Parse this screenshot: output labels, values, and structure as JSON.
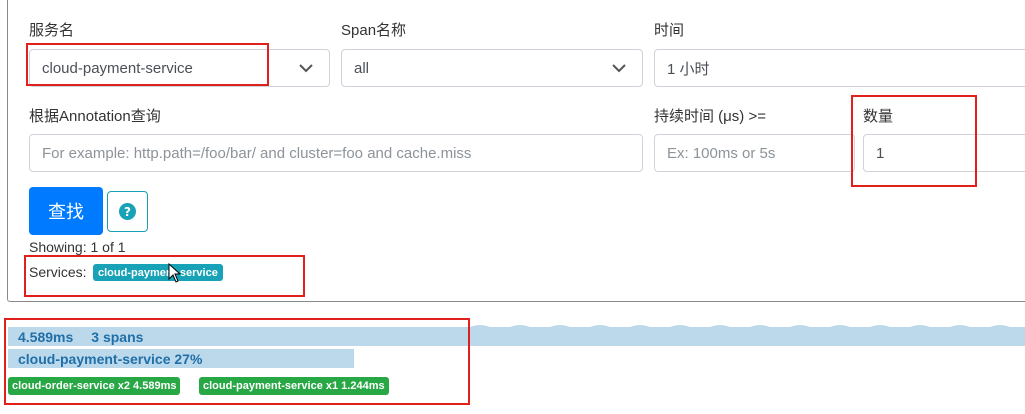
{
  "form": {
    "service_label": "服务名",
    "service_value": "cloud-payment-service",
    "span_label": "Span名称",
    "span_value": "all",
    "time_label": "时间",
    "time_value": "1 小时",
    "annotation_label": "根据Annotation查询",
    "annotation_placeholder": "For example: http.path=/foo/bar/ and cluster=foo and cache.miss",
    "duration_label": "持续时间 (μs) >=",
    "duration_placeholder": "Ex: 100ms or 5s",
    "limit_label": "数量",
    "limit_value": "1",
    "search_button": "查找",
    "help_icon": "?"
  },
  "summary": {
    "showing": "Showing: 1 of 1",
    "services_label": "Services:",
    "service_badge": "cloud-payment-service"
  },
  "result": {
    "duration": "4.589ms",
    "spans": "3 spans",
    "service_percent": "cloud-payment-service 27%",
    "badges": [
      "cloud-order-service x2 4.589ms",
      "cloud-payment-service x1 1.244ms"
    ]
  },
  "colors": {
    "primary": "#007bff",
    "info": "#17a2b8",
    "success": "#28a745",
    "highlight": "#e0201a",
    "result_bar": "#bcd9ec"
  },
  "icons": {
    "dropdown": "chevron-down-icon",
    "help": "question-circle-icon",
    "cursor": "mouse-cursor-icon"
  }
}
